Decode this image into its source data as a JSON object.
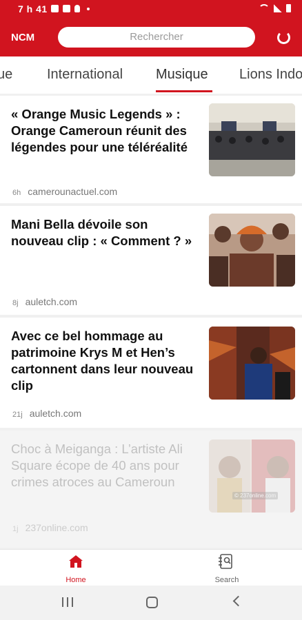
{
  "status": {
    "time": "7 h 41"
  },
  "header": {
    "logo": "NCM",
    "search_placeholder": "Rechercher"
  },
  "tabs": [
    {
      "label": "ue"
    },
    {
      "label": "International"
    },
    {
      "label": "Musique",
      "active": true
    },
    {
      "label": "Lions Indo"
    }
  ],
  "articles": [
    {
      "title": "« Orange Music Legends » : Orange Cameroun réunit des légendes pour une téléréalité",
      "age": "6h",
      "source": "camerounactuel.com"
    },
    {
      "title": "Mani Bella dévoile son nouveau clip : « Comment ? »",
      "age": "8j",
      "source": "auletch.com"
    },
    {
      "title": "Avec ce bel hommage au patrimoine Krys M et Hen’s cartonnent dans leur nouveau clip",
      "age": "21j",
      "source": "auletch.com"
    },
    {
      "title": "Choc à Meiganga : L’artiste Ali Square écope de 40 ans pour crimes atroces au Cameroun",
      "age": "1j",
      "source": "237online.com",
      "thumb_caption": "© 237online.com"
    }
  ],
  "bottom_nav": {
    "home": "Home",
    "search": "Search"
  },
  "colors": {
    "brand": "#d1141f"
  }
}
